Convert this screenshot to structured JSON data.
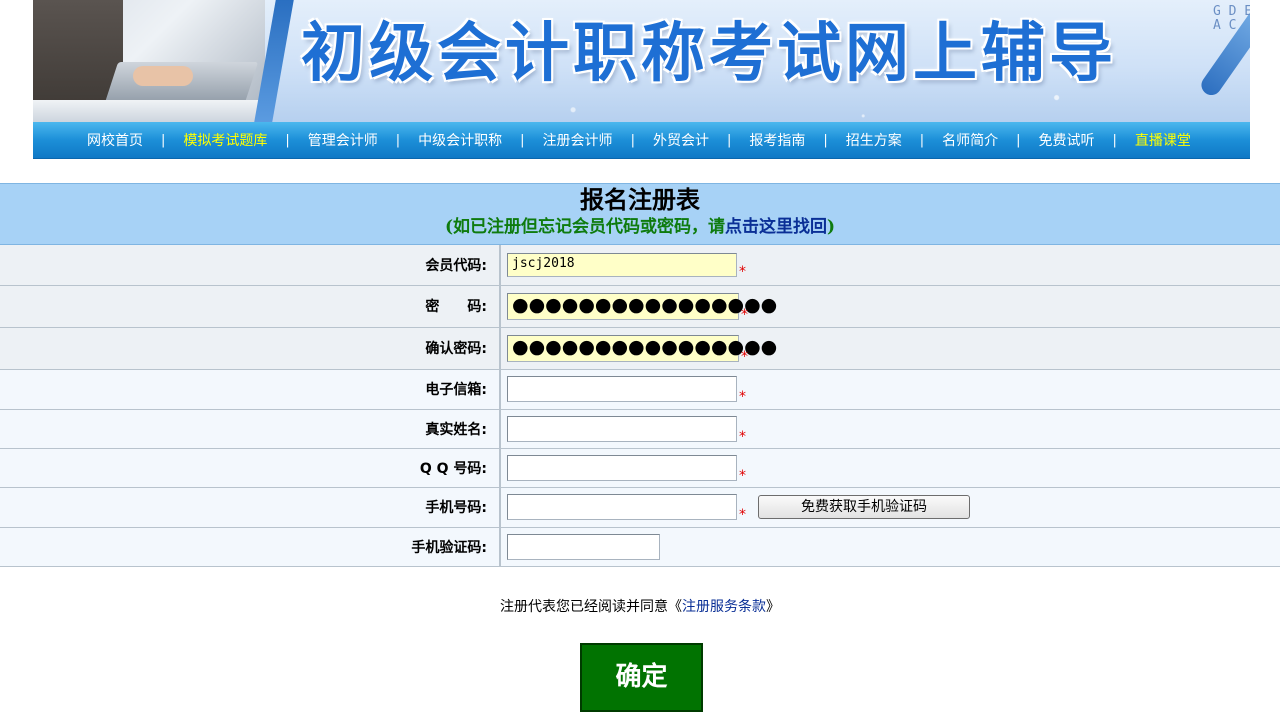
{
  "banner": {
    "title": "初级会计职称考试网上辅导",
    "decor_letters": "G D E B A C"
  },
  "nav": {
    "items": [
      {
        "label": "网校首页",
        "highlight": false
      },
      {
        "label": "模拟考试题库",
        "highlight": true
      },
      {
        "label": "管理会计师",
        "highlight": false
      },
      {
        "label": "中级会计职称",
        "highlight": false
      },
      {
        "label": "注册会计师",
        "highlight": false
      },
      {
        "label": "外贸会计",
        "highlight": false
      },
      {
        "label": "报考指南",
        "highlight": false
      },
      {
        "label": "招生方案",
        "highlight": false
      },
      {
        "label": "名师简介",
        "highlight": false
      },
      {
        "label": "免费试听",
        "highlight": false
      },
      {
        "label": "直播课堂",
        "highlight": true
      }
    ],
    "separator": "|"
  },
  "form": {
    "title": "报名注册表",
    "subtitle_prefix": "(如已注册但忘记会员代码或密码，请",
    "subtitle_link": "点击这里找回",
    "subtitle_suffix": ")",
    "required_mark": "*",
    "fields": {
      "member_code": {
        "label": "会员代码:",
        "value": "jscj2018"
      },
      "password": {
        "label": "密　　码:",
        "value": "●●●●●●●●●●●●●●●●"
      },
      "confirm_password": {
        "label": "确认密码:",
        "value": "●●●●●●●●●●●●●●●●"
      },
      "email": {
        "label": "电子信箱:",
        "value": ""
      },
      "real_name": {
        "label": "真实姓名:",
        "value": ""
      },
      "qq": {
        "label": "Q Q 号码:",
        "value": ""
      },
      "phone": {
        "label": "手机号码:",
        "value": ""
      },
      "sms_code": {
        "label": "手机验证码:",
        "value": ""
      }
    },
    "sms_button": "免费获取手机验证码"
  },
  "agreement": {
    "prefix": "注册代表您已经阅读并同意《",
    "link": "注册服务条款",
    "suffix": "》"
  },
  "submit_label": "确定",
  "colors": {
    "nav_bg": "#1c8fd8",
    "nav_highlight": "#ffff00",
    "header_bg": "#a7d2f6",
    "subtitle_green": "#0e7b0e",
    "link_blue": "#0a2f96",
    "required_red": "#e00000",
    "submit_green": "#017301",
    "filled_input_bg": "#ffffc8"
  }
}
